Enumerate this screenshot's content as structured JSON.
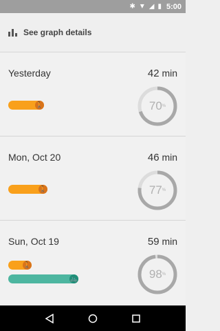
{
  "status_bar": {
    "time": "5:00",
    "icons": [
      "bluetooth-icon",
      "wifi-icon",
      "signal-icon",
      "battery-icon"
    ]
  },
  "details": {
    "label": "See graph details",
    "icon": "bar-chart-icon"
  },
  "days": [
    {
      "date": "Yesterday",
      "minutes": "42",
      "unit": "min",
      "goal_percent": "70",
      "goal_fraction": 0.7,
      "activities": [
        {
          "type": "walking",
          "icon": "walking-icon",
          "relative_length": 0.55
        }
      ]
    },
    {
      "date": "Mon, Oct 20",
      "minutes": "46",
      "unit": "min",
      "goal_percent": "77",
      "goal_fraction": 0.77,
      "activities": [
        {
          "type": "walking",
          "icon": "walking-icon",
          "relative_length": 0.6
        }
      ]
    },
    {
      "date": "Sun, Oct 19",
      "minutes": "59",
      "unit": "min",
      "goal_percent": "98",
      "goal_fraction": 0.98,
      "activities": [
        {
          "type": "walking",
          "icon": "walking-icon",
          "relative_length": 0.35
        },
        {
          "type": "biking",
          "icon": "biking-icon",
          "relative_length": 1.0
        }
      ]
    }
  ],
  "colors": {
    "walking": "#f9a01b",
    "biking": "#4db6a0",
    "ring_track": "#dcdcdc",
    "ring_fill": "#a8a8a8"
  },
  "nav": [
    "back-icon",
    "home-icon",
    "recents-icon"
  ]
}
